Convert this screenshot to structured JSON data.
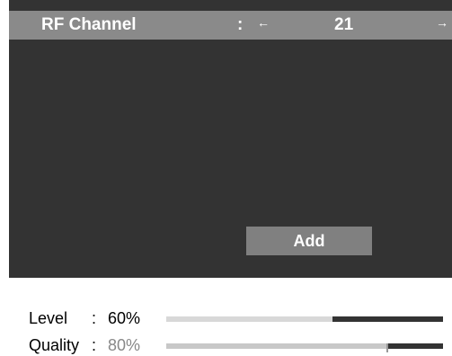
{
  "header": {
    "title": "RF Channel",
    "separator": ":",
    "left_arrow": "←",
    "value": "21",
    "right_arrow": "→"
  },
  "actions": {
    "add_label": "Add"
  },
  "signal": {
    "level": {
      "label": "Level",
      "separator": ":",
      "value_text": "60%",
      "value": 60
    },
    "quality": {
      "label": "Quality",
      "separator": ":",
      "value_text": "80%",
      "value": 80
    }
  }
}
